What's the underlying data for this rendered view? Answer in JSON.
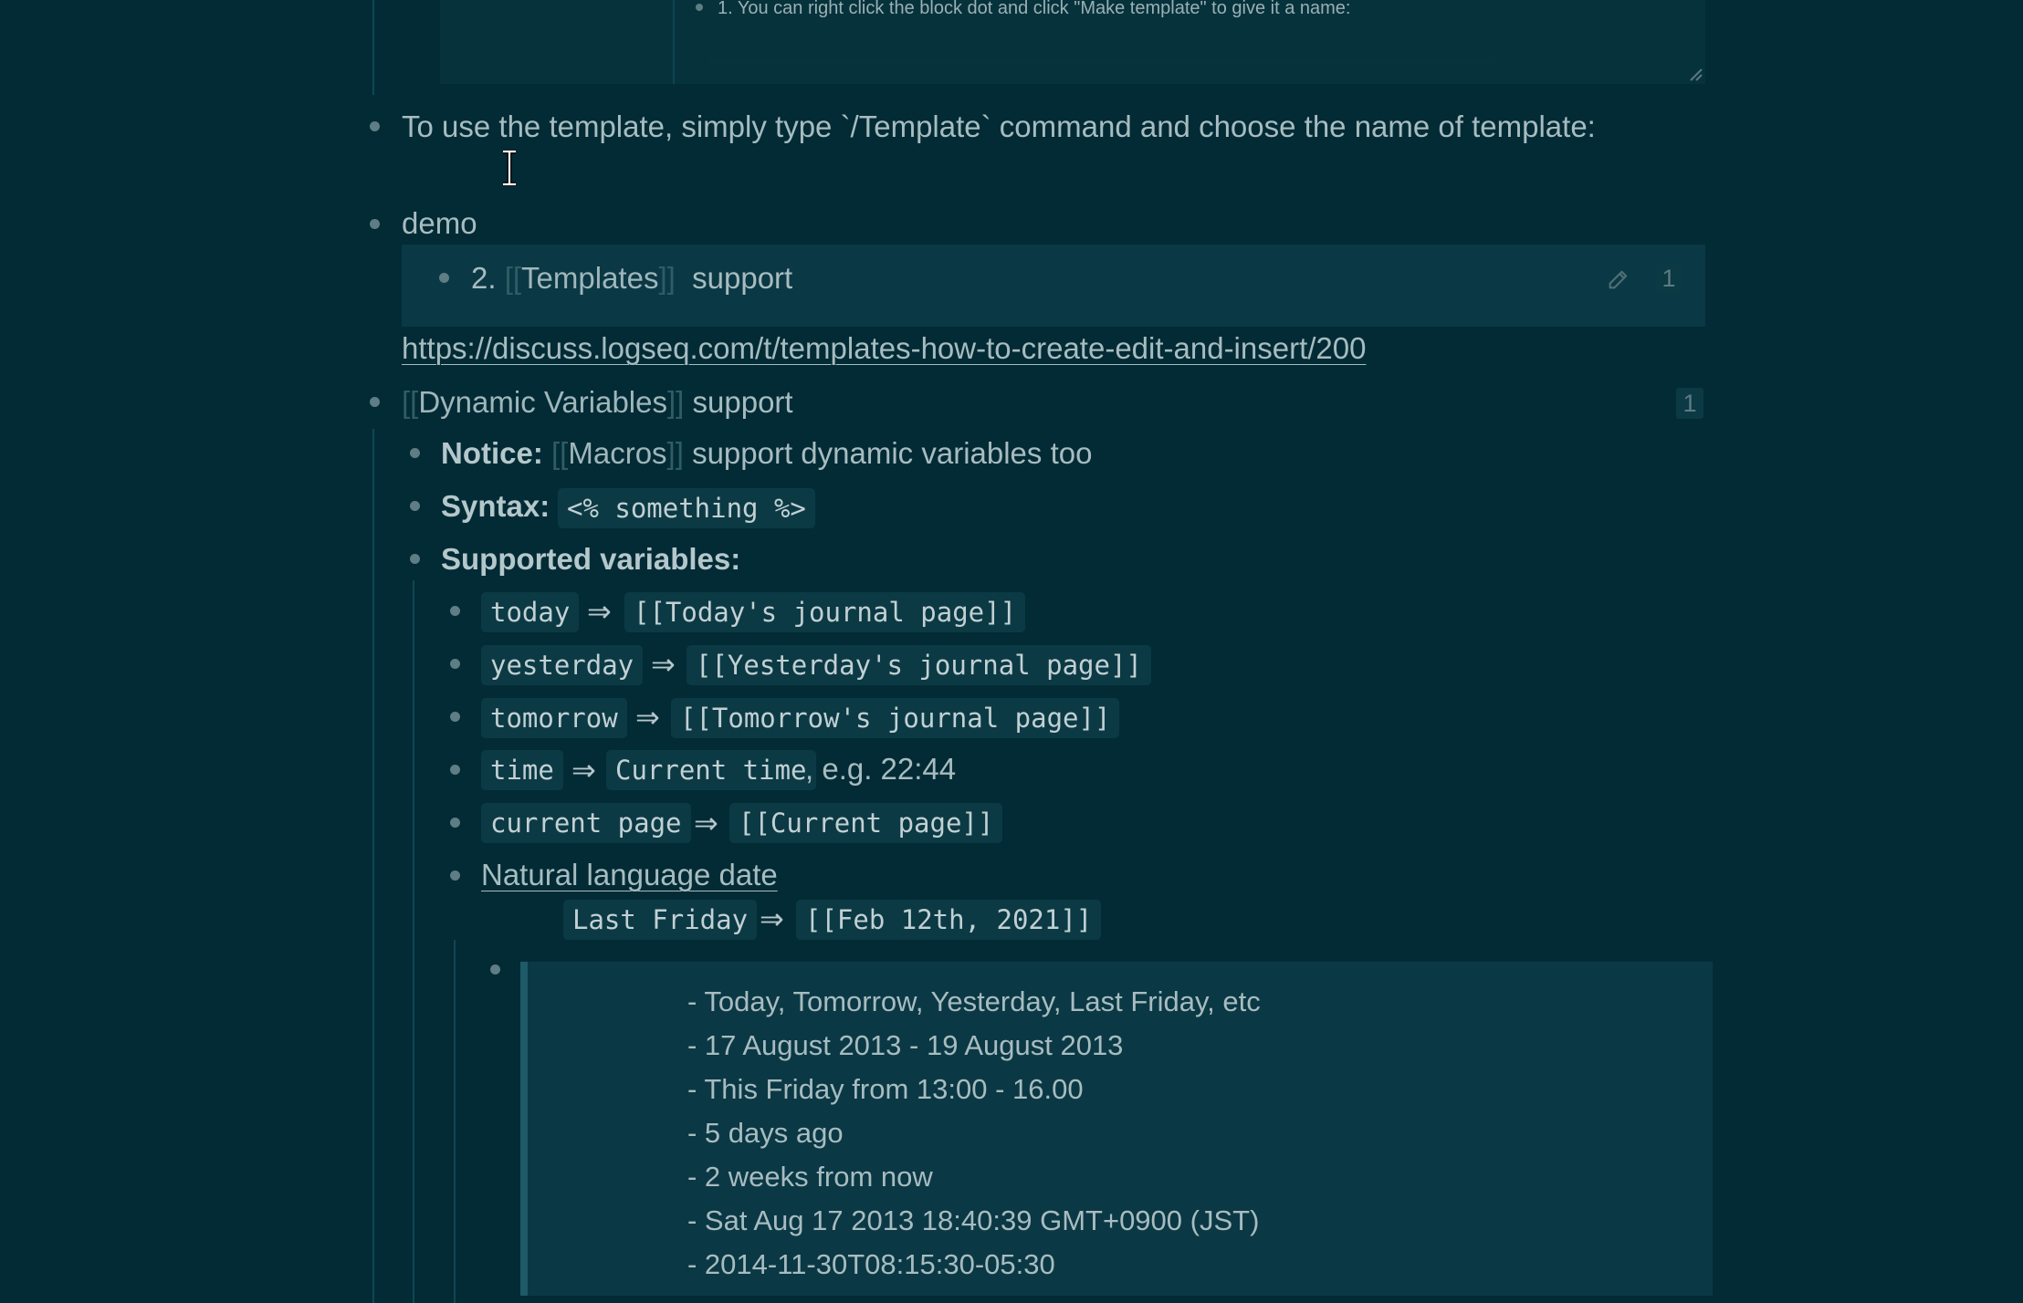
{
  "top_embed": {
    "hint_text": "1. You can right click the block dot and click \"Make template\" to give it a name:"
  },
  "blocks": {
    "use_template": "To use the template, simply type `/Template` command and choose the name of template:",
    "demo": "demo",
    "demo_ref": {
      "prefix": "2.",
      "page": "Templates",
      "suffix": "support",
      "ref_count": "1"
    },
    "discuss_link": "https://discuss.logseq.com/t/templates-how-to-create-edit-and-insert/200",
    "dynamic": {
      "page": "Dynamic Variables",
      "suffix": "support",
      "ref_count": "1"
    },
    "notice": {
      "label": "Notice:",
      "page": "Macros",
      "text": "support dynamic variables too"
    },
    "syntax": {
      "label": "Syntax:",
      "code": "<% something %>"
    },
    "supported": {
      "label": "Supported variables:"
    },
    "variables": [
      {
        "name": "today",
        "arrow": "⇒",
        "value": "[[Today's journal page]]"
      },
      {
        "name": "yesterday",
        "arrow": "⇒",
        "value": "[[Yesterday's journal page]]"
      },
      {
        "name": "tomorrow",
        "arrow": "⇒",
        "value": "[[Tomorrow's journal page]]"
      },
      {
        "name": "time",
        "arrow": "⇒",
        "value": "Current time",
        "extra": ", e.g. 22:44"
      },
      {
        "name": "current page",
        "arrow": "⇒",
        "value": "[[Current page]]"
      }
    ],
    "natural": {
      "link": "Natural language date",
      "example_name": "Last Friday",
      "arrow": "⇒",
      "example_value": "[[Feb 12th, 2021]]"
    },
    "quote_lines": [
      "- Today, Tomorrow, Yesterday, Last Friday, etc",
      "- 17 August 2013 - 19 August 2013",
      "- This Friday from 13:00 - 16.00",
      "- 5 days ago",
      "- 2 weeks from now",
      "- Sat Aug 17 2013 18:40:39 GMT+0900 (JST)",
      "- 2014-11-30T08:15:30-05:30"
    ]
  },
  "icons": {
    "edit": "pencil-icon",
    "cursor": "text-cursor-icon"
  }
}
